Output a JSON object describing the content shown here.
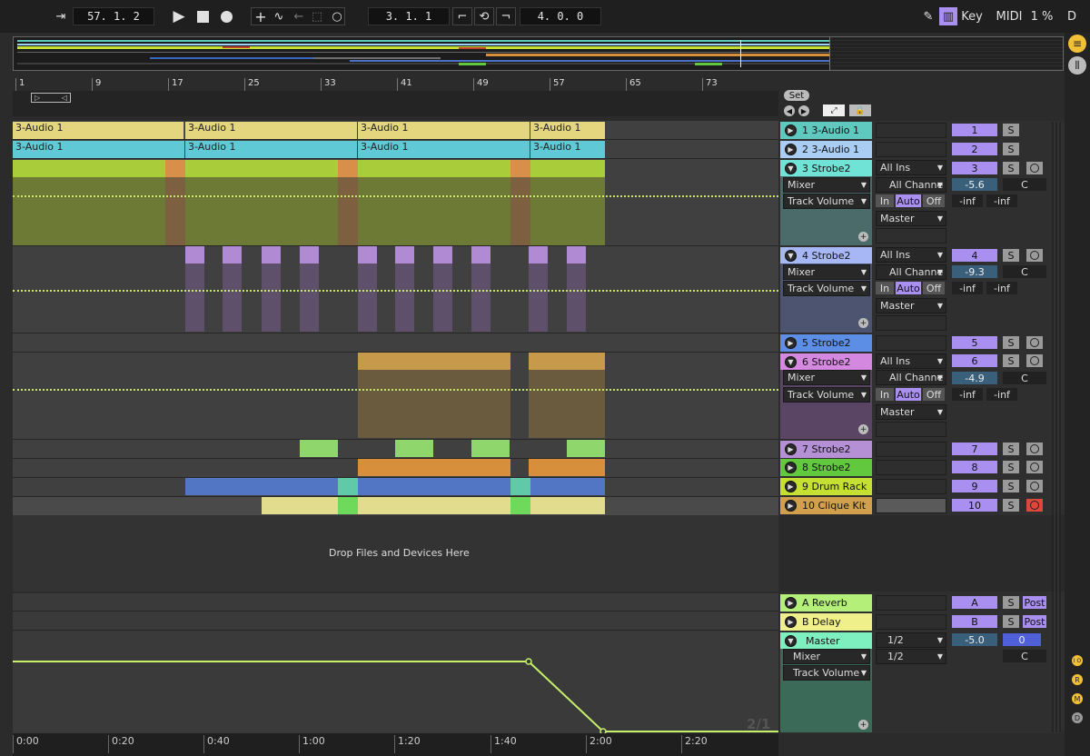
{
  "toolbar": {
    "position": "57.  1.  2",
    "loop_start": "3.  1.  1",
    "loop_length": "4.  0.  0",
    "key_label": "Key",
    "midi_label": "MIDI",
    "cpu_label": "1 %",
    "d_label": "D"
  },
  "ruler": {
    "bars": [
      "1",
      "9",
      "17",
      "25",
      "33",
      "41",
      "49",
      "57",
      "65",
      "73"
    ]
  },
  "session": {
    "set_label": "Set"
  },
  "clips": {
    "audio1_name": "3-Audio 1",
    "audio2_name": "3-Audio 1"
  },
  "drop_hint": "Drop Files and Devices Here",
  "tracks": [
    {
      "name": "1 3-Audio 1",
      "num": "1",
      "solo": "S",
      "color": "#5fc9c0"
    },
    {
      "name": "2 3-Audio 1",
      "num": "2",
      "solo": "S",
      "color": "#9fd3f3"
    },
    {
      "name": "3 Strobe2",
      "num": "3",
      "solo": "S",
      "color": "#70e3d6",
      "input": "All Ins",
      "channel": "All Channe",
      "mixer": "Mixer",
      "param": "Track Volume",
      "volume": "-5.6",
      "pan": "C",
      "mon_in": "In",
      "mon_auto": "Auto",
      "mon_off": "Off",
      "out": "Master",
      "inf1": "-inf",
      "inf2": "-inf"
    },
    {
      "name": "4 Strobe2",
      "num": "4",
      "solo": "S",
      "color": "#a7b6f5",
      "input": "All Ins",
      "channel": "All Channe",
      "mixer": "Mixer",
      "param": "Track Volume",
      "volume": "-9.3",
      "pan": "C",
      "mon_in": "In",
      "mon_auto": "Auto",
      "mon_off": "Off",
      "out": "Master",
      "inf1": "-inf",
      "inf2": "-inf"
    },
    {
      "name": "5 Strobe2",
      "num": "5",
      "solo": "S",
      "color": "#5c8ee6"
    },
    {
      "name": "6 Strobe2",
      "num": "6",
      "solo": "S",
      "color": "#d588e0",
      "input": "All Ins",
      "channel": "All Channe",
      "mixer": "Mixer",
      "param": "Track Volume",
      "volume": "-4.9",
      "pan": "C",
      "mon_in": "In",
      "mon_auto": "Auto",
      "mon_off": "Off",
      "out": "Master",
      "inf1": "-inf",
      "inf2": "-inf"
    },
    {
      "name": "7 Strobe2",
      "num": "7",
      "solo": "S",
      "color": "#b590d4"
    },
    {
      "name": "8 Strobe2",
      "num": "8",
      "solo": "S",
      "color": "#62c93f"
    },
    {
      "name": "9 Drum Rack",
      "num": "9",
      "solo": "S",
      "color": "#c6df33"
    },
    {
      "name": "10 Clique Kit",
      "num": "10",
      "solo": "S",
      "color": "#d1a04c"
    }
  ],
  "returns": [
    {
      "name": "A Reverb",
      "letter": "A",
      "solo": "S",
      "post": "Post",
      "color": "#b4ef7a"
    },
    {
      "name": "B Delay",
      "letter": "B",
      "solo": "S",
      "post": "Post",
      "color": "#f0f08a"
    }
  ],
  "master": {
    "name": "Master",
    "color": "#7ef0c0",
    "mixer": "Mixer",
    "param": "Track Volume",
    "cue1": "1/2",
    "cue2": "1/2",
    "volume": "-5.0",
    "cue_vol": "0",
    "pan": "C",
    "zoom": "2/1"
  },
  "timeline": [
    "0:00",
    "0:20",
    "0:40",
    "1:00",
    "1:20",
    "1:40",
    "2:00",
    "2:20"
  ],
  "right_buttons": [
    "I O",
    "R",
    "M",
    "D"
  ]
}
